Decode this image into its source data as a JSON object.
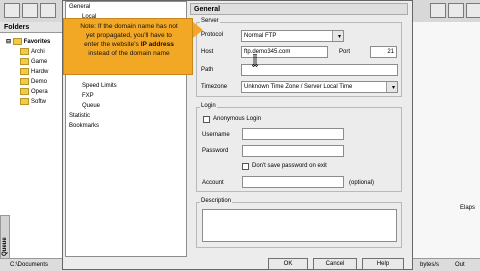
{
  "left_panel": {
    "header": "Folders",
    "tree_root": "Favorites",
    "items": [
      "Archi",
      "Game",
      "Hardw",
      "Demo",
      "Opera",
      "Softw"
    ],
    "queue_label": "Queue",
    "status_path": "C:\\Documents"
  },
  "right_bg": {
    "col_label": "Elaps",
    "rate": "bytes/s",
    "out": "Out"
  },
  "dialog": {
    "tree": {
      "items": [
        "General",
        "Local",
        "Speed Limits",
        "FXP",
        "Queue",
        "Statistic",
        "Bookmarks"
      ]
    },
    "panel_header": "General",
    "server_group_title": "Server",
    "protocol_label": "Protocol",
    "protocol_value": "Normal FTP",
    "host_label": "Host",
    "host_value": "ftp.demo345.com",
    "port_label": "Port",
    "port_value": "21",
    "path_label": "Path",
    "path_value": "",
    "timezone_label": "Timezone",
    "timezone_value": "Unknown Time Zone / Server Local Time",
    "login_group_title": "Login",
    "anonymous_label": "Anonymous Login",
    "username_label": "Username",
    "username_value": "",
    "password_label": "Password",
    "password_value": "",
    "dont_save_label": "Don't save password on exit",
    "account_label": "Account",
    "account_value": "",
    "account_hint": "(optional)",
    "description_group_title": "Description",
    "description_value": "",
    "ok_label": "OK",
    "cancel_label": "Cancel",
    "help_label": "Help"
  },
  "callout": {
    "line1": "Note: If the domain name has not",
    "line2": "yet propagated, you'll have to",
    "line3a": "enter the website's ",
    "line3b": "IP address",
    "line4": "instead of the domain name"
  },
  "colors": {
    "callout_bg": "#f3a825",
    "dialog_bg": "#ececec"
  }
}
